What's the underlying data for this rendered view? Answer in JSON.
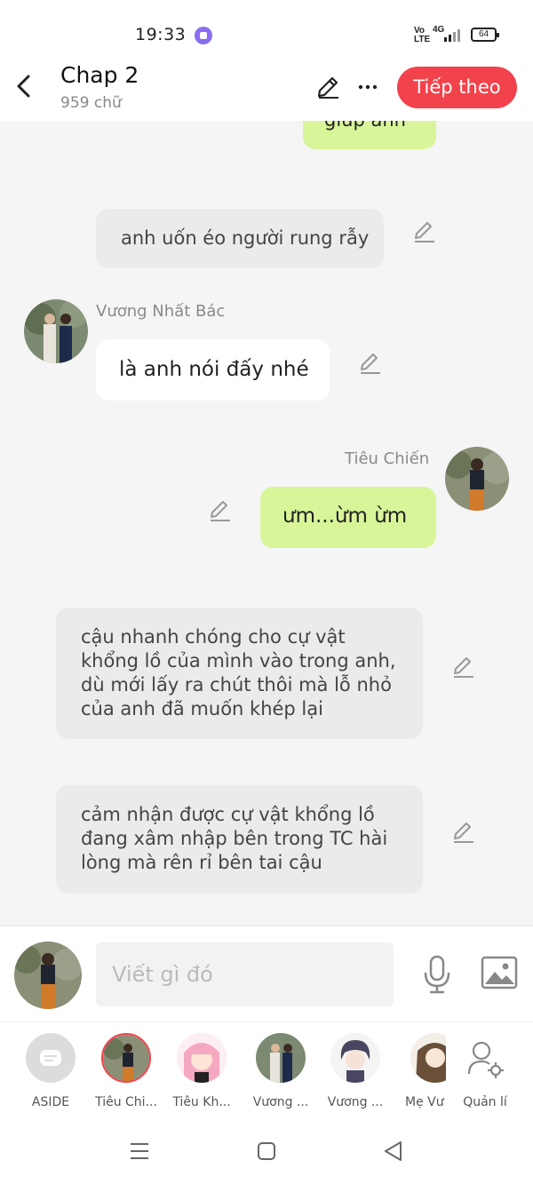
{
  "status_bar": {
    "time": "19:33",
    "volte": "Vo LTE",
    "network": "4G",
    "battery": "64"
  },
  "header": {
    "title": "Chap 2",
    "subtitle": "959 chữ",
    "next_button": "Tiếp theo"
  },
  "messages": {
    "top_partial": "giúp anh",
    "aside_1": "anh uốn éo người rung rẫy",
    "m1_sender": "Vương Nhất Bác",
    "m1_text": "là anh nói đấy nhé",
    "m2_sender": "Tiêu Chiến",
    "m2_text": "ưm...ừm ừm",
    "aside_2": "cậu nhanh chóng cho cự vật khổng lồ của mình vào trong anh, dù mới lấy ra chút thôi mà lỗ nhỏ của anh đã muốn khép lại",
    "aside_3": "cảm nhận được cự vật khổng lồ đang xâm nhập bên trong TC hài lòng mà rên rỉ bên tai cậu"
  },
  "composer": {
    "placeholder": "Viết gì đó"
  },
  "characters": [
    {
      "label": "ASIDE"
    },
    {
      "label": "Tiêu Chi..."
    },
    {
      "label": "Tiêu Kh..."
    },
    {
      "label": "Vương ..."
    },
    {
      "label": "Vương ..."
    },
    {
      "label": "Mẹ Vư"
    },
    {
      "label": "Quản lí"
    }
  ],
  "colors": {
    "accent": "#f2424b",
    "right_bubble": "#d8f59a",
    "aside_bubble": "#ebebeb"
  }
}
